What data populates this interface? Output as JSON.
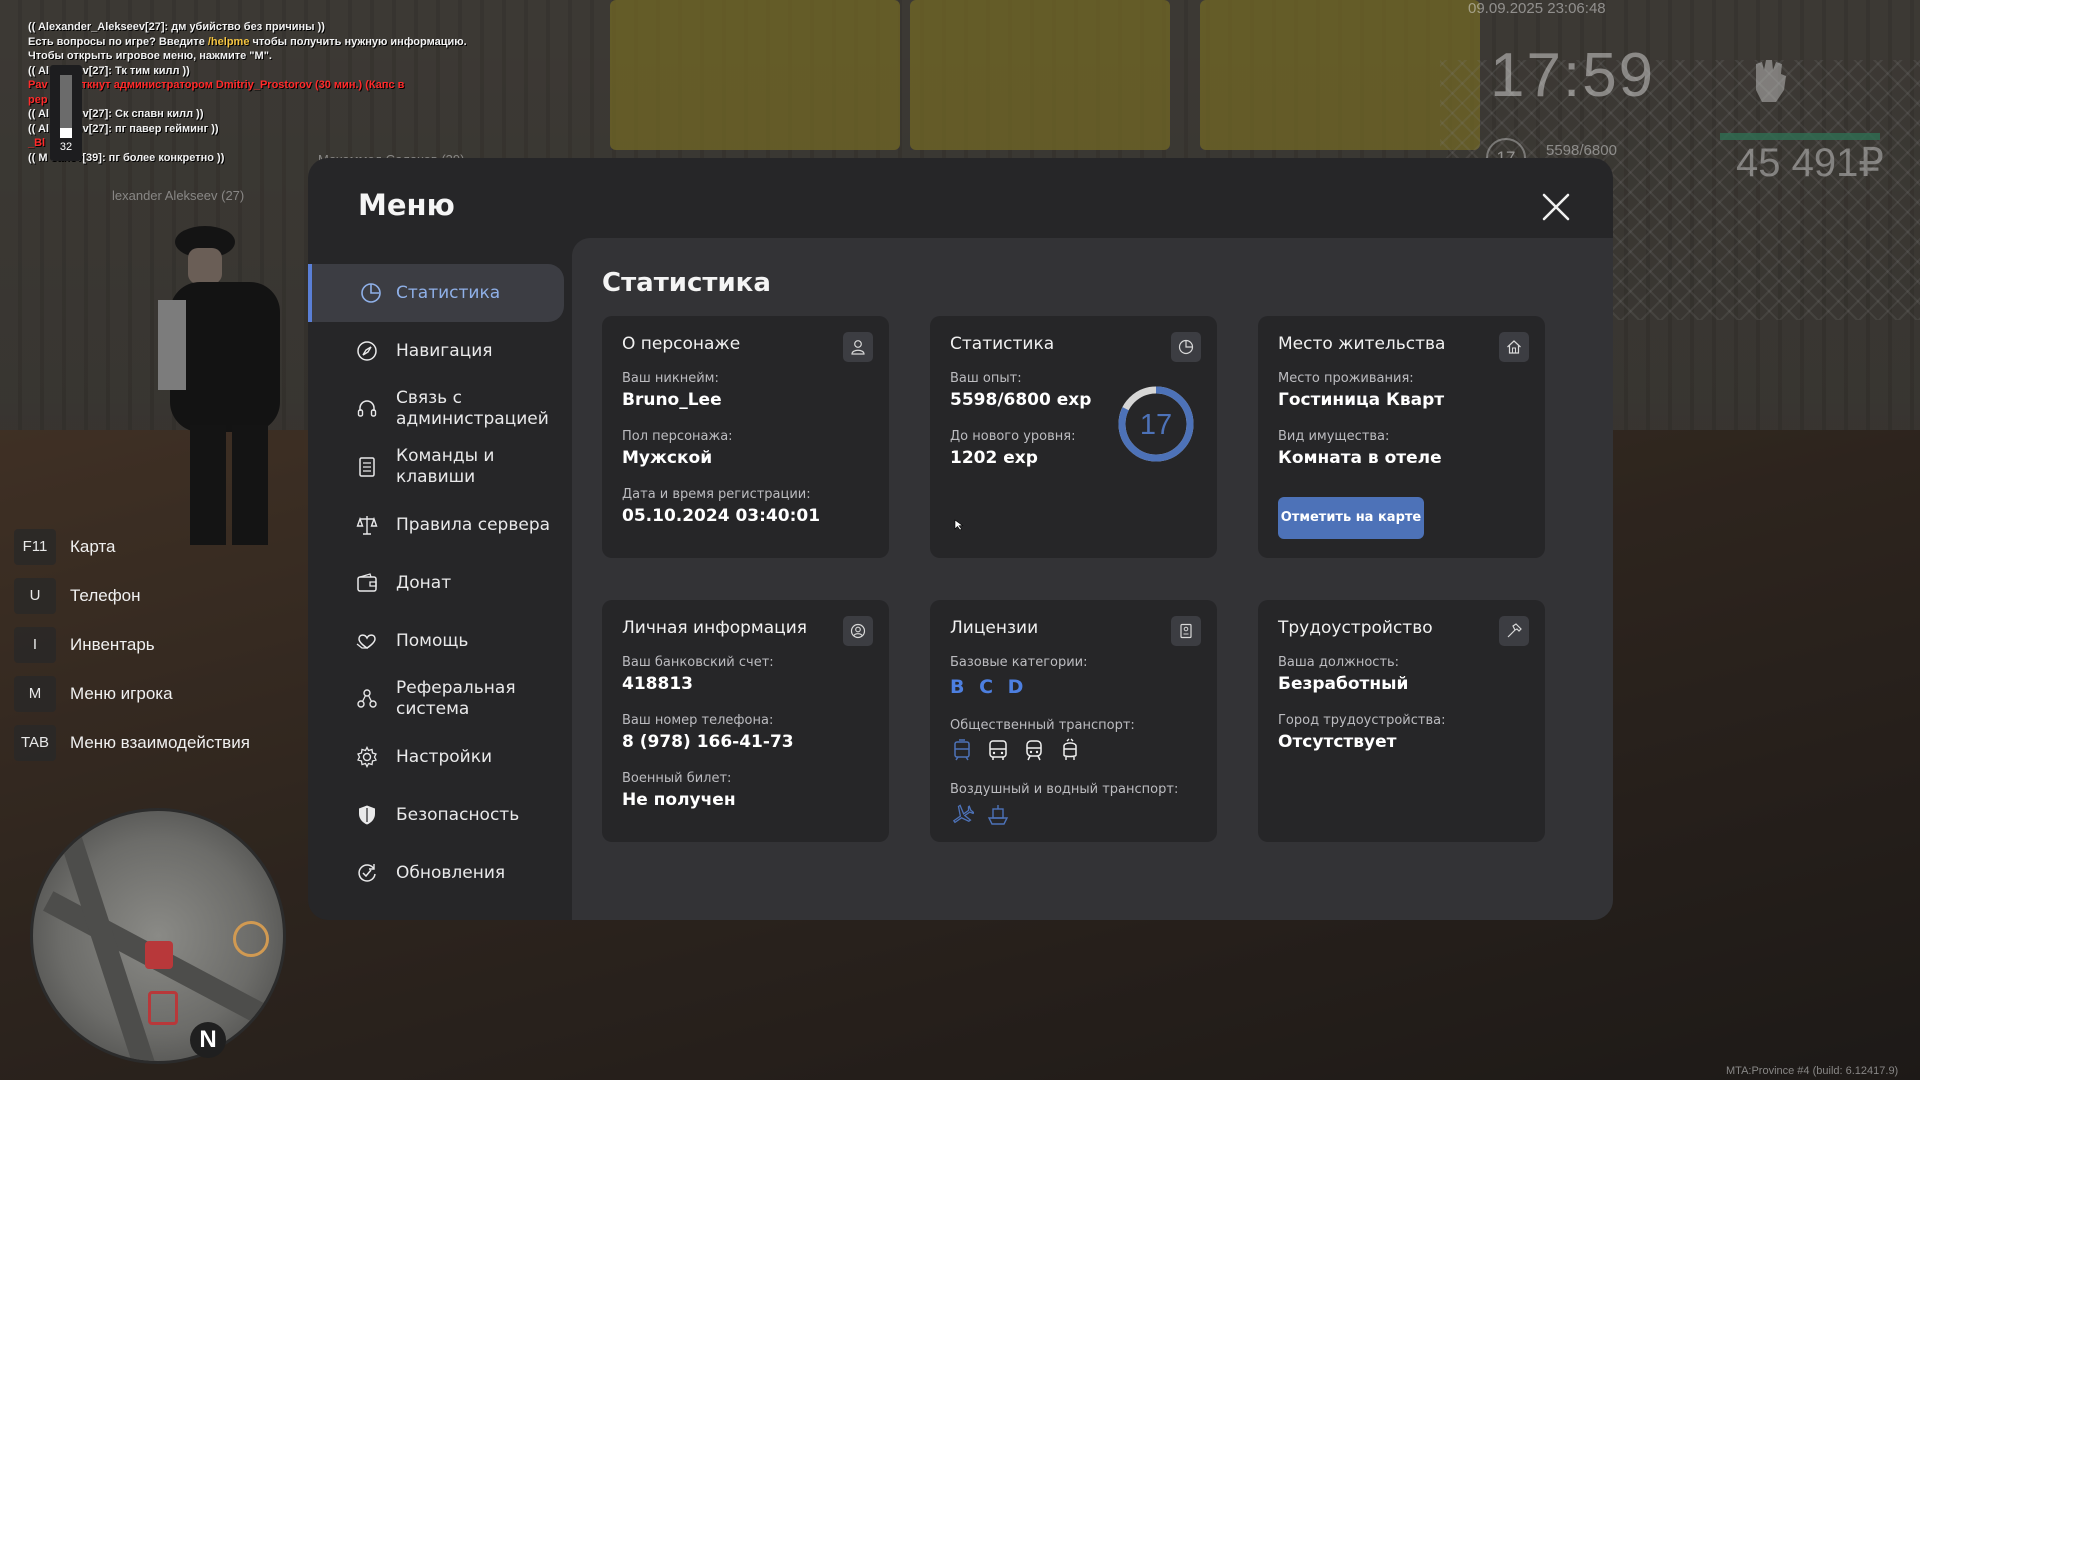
{
  "chat": {
    "lines": [
      {
        "text": "(( Alexander_Alekseev[27]: дм убийство без причины ))",
        "color": "white"
      },
      {
        "text_a": "Есть вопросы по игре? Введите ",
        "text_b": "/helpme",
        "text_c": " чтобы получить нужную информацию."
      },
      {
        "text": "Чтобы открыть игровое меню, нажмите \"M\".",
        "color": "white"
      },
      {
        "text": "(( Al          ekseev[27]: Тк тим килл ))",
        "color": "white"
      },
      {
        "text": "Pav          ыл заткнут администратором Dmitriy_Prostorov (30 мин.) (Капс в",
        "color": "red"
      },
      {
        "text": "pep",
        "color": "red"
      },
      {
        "text": "(( Al          ekseev[27]: Ск спавн килл ))",
        "color": "white"
      },
      {
        "text": "(( Al          ekseev[27]: пг павер гейминг ))",
        "color": "white"
      },
      {
        "text": "_Bl",
        "color": "red"
      },
      {
        "text": "(( M          sanov[39]: пг более конкретно ))",
        "color": "white"
      }
    ],
    "scroll_count": "32"
  },
  "nametags": [
    "Мохаммед Салахов (39)",
    "lexander Alekseev (27)"
  ],
  "hud": {
    "datetime": "09.09.2025 23:06:48",
    "time": "17:59",
    "level": "17",
    "exp": "5598/6800",
    "money": "45 491₽",
    "health_fraction": 0.95
  },
  "keys": [
    {
      "key": "F11",
      "label": "Карта"
    },
    {
      "key": "U",
      "label": "Телефон"
    },
    {
      "key": "I",
      "label": "Инвентарь"
    },
    {
      "key": "M",
      "label": "Меню игрока"
    },
    {
      "key": "TAB",
      "label": "Меню взаимодействия"
    }
  ],
  "minimap": {
    "north": "N"
  },
  "build": "MTA:Province #4 (build: 6.12417.9)",
  "menu": {
    "title": "Меню",
    "sidebar": [
      {
        "label": "Статистика",
        "icon": "pie-chart-icon",
        "active": true
      },
      {
        "label": "Навигация",
        "icon": "compass-icon"
      },
      {
        "label": "Связь с администрацией",
        "icon": "headset-icon"
      },
      {
        "label": "Команды и клавиши",
        "icon": "document-list-icon"
      },
      {
        "label": "Правила сервера",
        "icon": "scales-icon"
      },
      {
        "label": "Донат",
        "icon": "wallet-icon"
      },
      {
        "label": "Помощь",
        "icon": "heart-hands-icon"
      },
      {
        "label": "Реферальная система",
        "icon": "referral-network-icon"
      },
      {
        "label": "Настройки",
        "icon": "gear-icon"
      },
      {
        "label": "Безопасность",
        "icon": "shield-icon"
      },
      {
        "label": "Обновления",
        "icon": "refresh-check-icon"
      }
    ],
    "content": {
      "title": "Статистика",
      "character": {
        "title": "О персонаже",
        "icon": "person-icon",
        "nick_label": "Ваш никнейм:",
        "nick": "Bruno_Lee",
        "gender_label": "Пол персонажа:",
        "gender": "Мужской",
        "reg_label": "Дата и время регистрации:",
        "reg": "05.10.2024 03:40:01"
      },
      "stats": {
        "title": "Статистика",
        "icon": "pie-chart-icon",
        "exp_label": "Ваш опыт:",
        "exp": "5598/6800 exp",
        "next_label": "До нового уровня:",
        "next": "1202 exp",
        "level": "17",
        "level_progress": 0.823,
        "ring_color": "#4d72b8"
      },
      "residence": {
        "title": "Место жительства",
        "icon": "house-icon",
        "place_label": "Место проживания:",
        "place": "Гостиница Кварт",
        "type_label": "Вид имущества:",
        "type": "Комната в отеле",
        "button": "Отметить на карте"
      },
      "personal": {
        "title": "Личная информация",
        "icon": "user-circle-icon",
        "bank_label": "Ваш банковский счет:",
        "bank": "418813",
        "phone_label": "Ваш номер телефона:",
        "phone": "8 (978) 166-41-73",
        "military_label": "Военный билет:",
        "military": "Не получен"
      },
      "licenses": {
        "title": "Лицензии",
        "icon": "id-badge-icon",
        "base_label": "Базовые категории:",
        "base": "B C D",
        "public_label": "Общественный транспорт:",
        "public_icons": [
          "tram-icon",
          "bus-icon",
          "train-icon",
          "trolleybus-icon"
        ],
        "air_label": "Воздушный и водный транспорт:",
        "air_icons": [
          "plane-icon",
          "boat-icon"
        ]
      },
      "employment": {
        "title": "Трудоустройство",
        "icon": "hammer-icon",
        "position_label": "Ваша должность:",
        "position": "Безработный",
        "city_label": "Город трудоустройства:",
        "city": "Отсутствует"
      }
    }
  }
}
